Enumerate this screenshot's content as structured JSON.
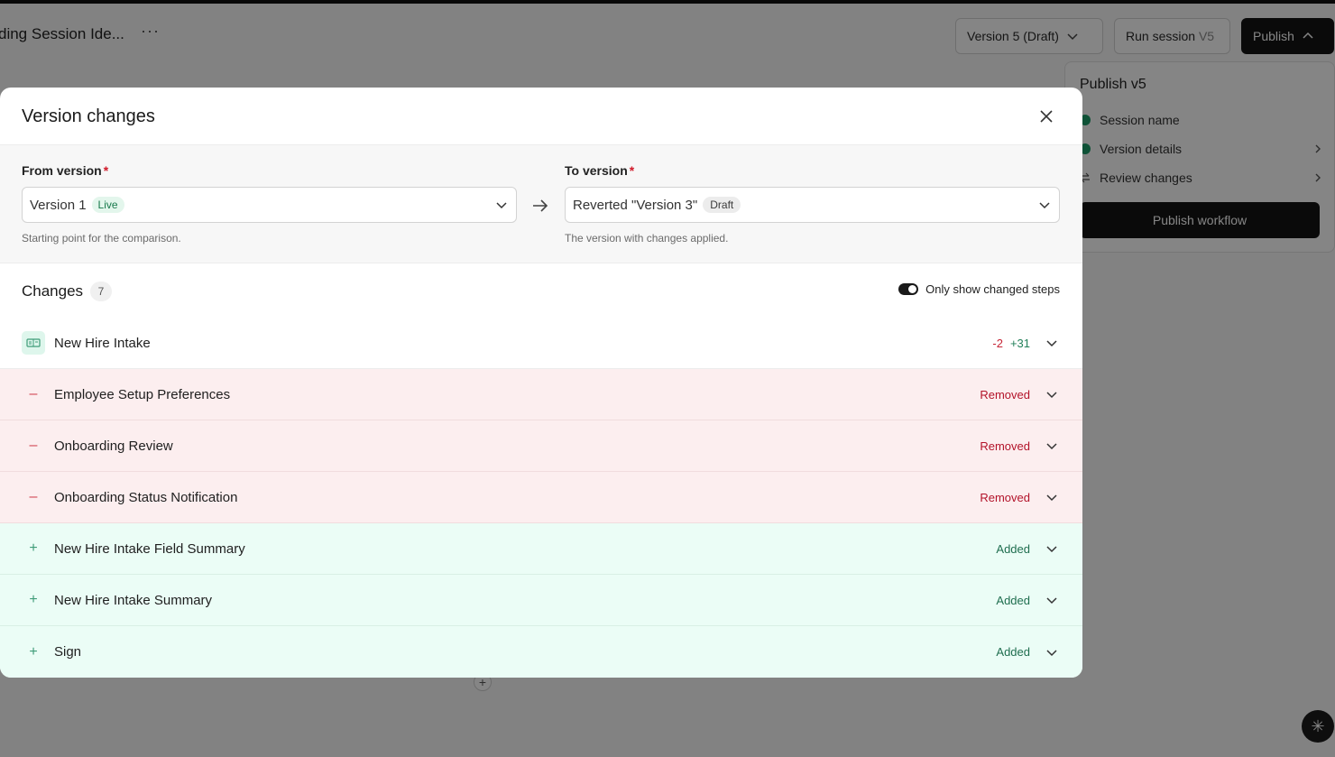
{
  "app": {
    "title": "ding Session Ide...",
    "more": "···",
    "version_select": "Version 5 (Draft)",
    "run_label": "Run session",
    "run_version": "V5",
    "publish_label": "Publish"
  },
  "publish_panel": {
    "title": "Publish v5",
    "items": [
      {
        "label": "Session name",
        "status": "check"
      },
      {
        "label": "Version details",
        "status": "check"
      },
      {
        "label": "Review changes",
        "status": "compare"
      }
    ],
    "button": "Publish workflow"
  },
  "modal": {
    "title": "Version changes",
    "from": {
      "label": "From version",
      "required": "*",
      "value": "Version 1",
      "badge": "Live",
      "help": "Starting point for the comparison."
    },
    "to": {
      "label": "To version",
      "required": "*",
      "value": "Reverted \"Version 3\"",
      "badge": "Draft",
      "help": "The version with changes applied."
    },
    "changes": {
      "title": "Changes",
      "count": "7",
      "toggle_label": "Only show changed steps",
      "toggle_on": true,
      "rows": [
        {
          "name": "New Hire Intake",
          "kind": "modified",
          "minus": "-2",
          "plus": "+31"
        },
        {
          "name": "Employee Setup Preferences",
          "kind": "removed",
          "status": "Removed"
        },
        {
          "name": "Onboarding Review",
          "kind": "removed",
          "status": "Removed"
        },
        {
          "name": "Onboarding Status Notification",
          "kind": "removed",
          "status": "Removed"
        },
        {
          "name": "New Hire Intake Field Summary",
          "kind": "added",
          "status": "Added"
        },
        {
          "name": "New Hire Intake Summary",
          "kind": "added",
          "status": "Added"
        },
        {
          "name": "Sign",
          "kind": "added",
          "status": "Added"
        }
      ]
    }
  },
  "colors": {
    "removed_bg": "#fceeef",
    "added_bg": "#ebfdf6",
    "removed_text": "#b3132a",
    "added_text": "#1f6e4f",
    "primary": "#141414"
  }
}
